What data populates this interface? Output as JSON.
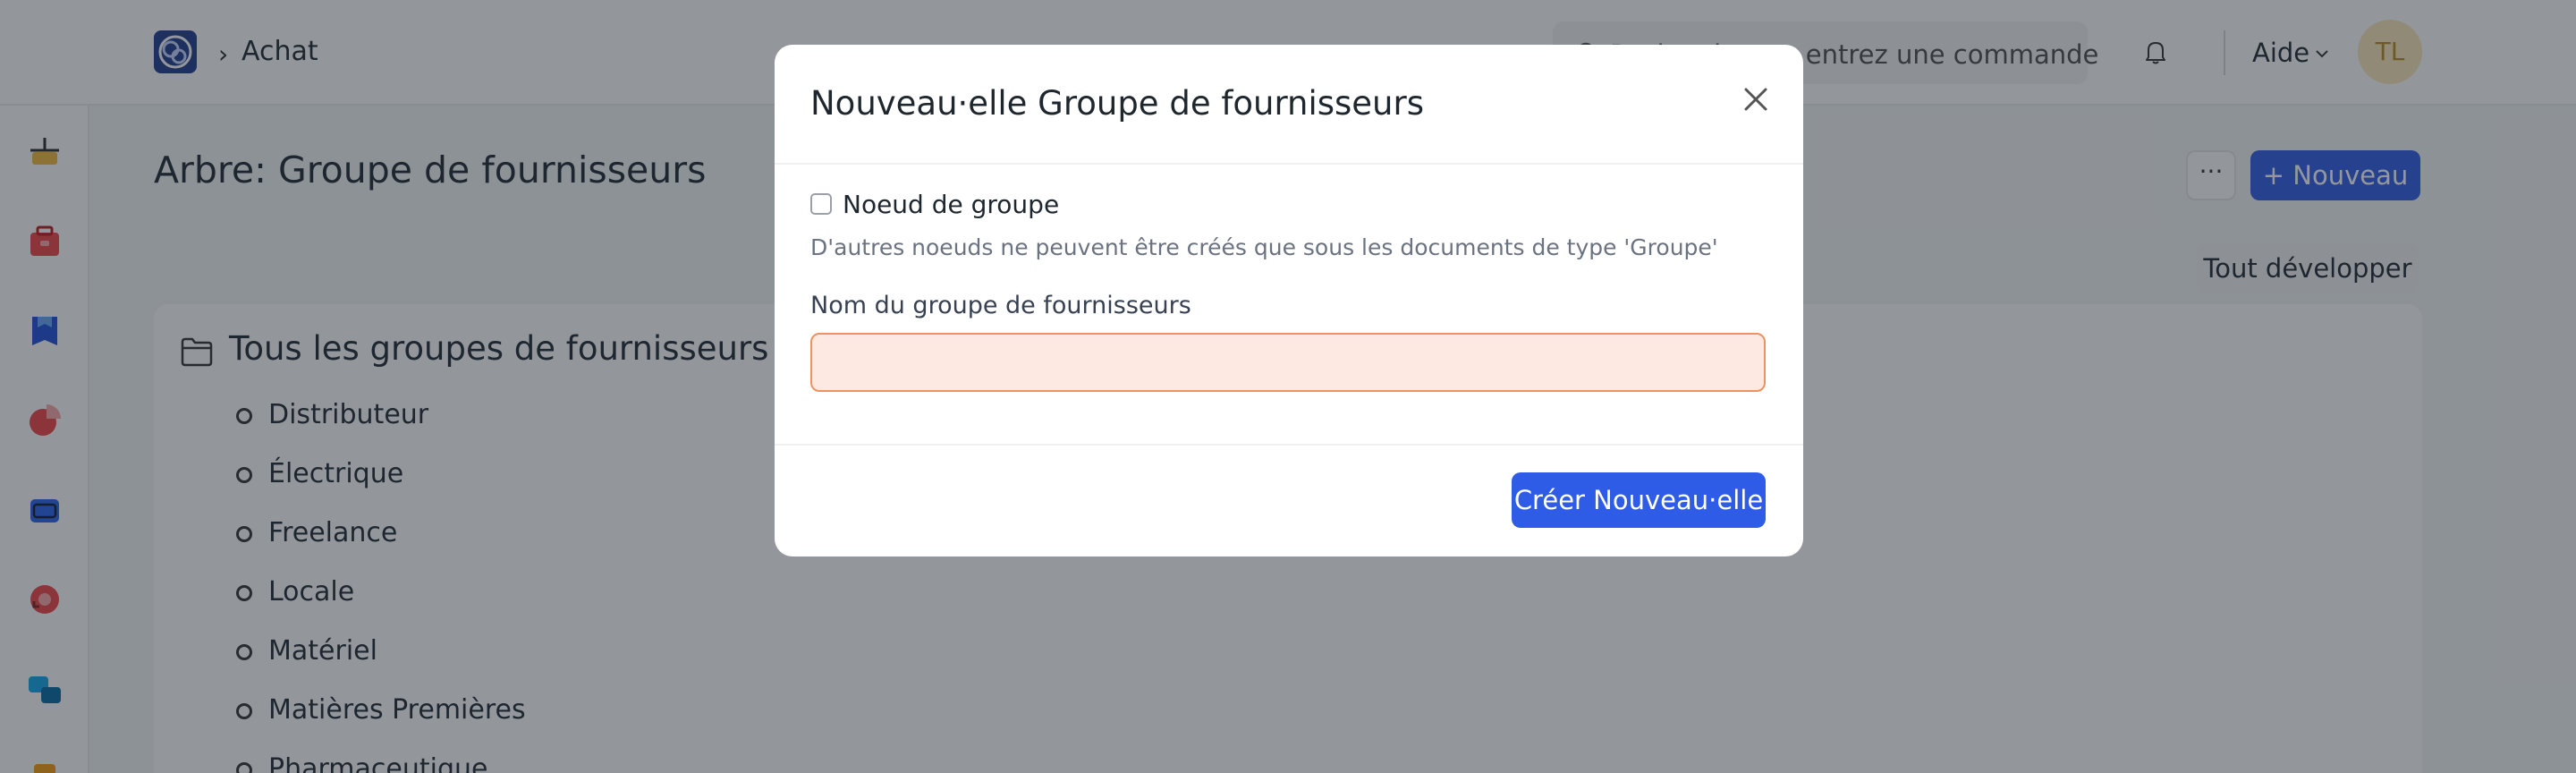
{
  "navbar": {
    "breadcrumb": "Achat",
    "search_text": "Rechercher ou entrez une commande",
    "help_label": "Aide",
    "avatar_initials": "TL"
  },
  "sidebar": {
    "icons": [
      "buying-icon",
      "stock-icon",
      "accounting-icon",
      "analytics-icon",
      "assets-icon",
      "support-icon",
      "projects-icon",
      "more-module-icon"
    ]
  },
  "page": {
    "title": "Arbre: Groupe de fournisseurs",
    "more_label": "···",
    "new_label": "+ Nouveau",
    "expand_label": "Tout développer"
  },
  "tree": {
    "root": "Tous les groupes de fournisseurs",
    "items": [
      "Distributeur",
      "Électrique",
      "Freelance",
      "Locale",
      "Matériel",
      "Matières Premières",
      "Pharmaceutique"
    ]
  },
  "modal": {
    "title": "Nouveau·elle Groupe de fournisseurs",
    "checkbox_label": "Noeud de groupe",
    "help_text": "D'autres noeuds ne peuvent être créés que sous les documents de type 'Groupe'",
    "field_label": "Nom du groupe de fournisseurs",
    "field_value": "",
    "create_label": "Créer Nouveau·elle"
  },
  "colors": {
    "primary": "#2f5ce6",
    "overlay": "rgba(30,38,48,0.48)",
    "input_error_bg": "#fde9e2",
    "input_error_border": "#f0925f"
  }
}
